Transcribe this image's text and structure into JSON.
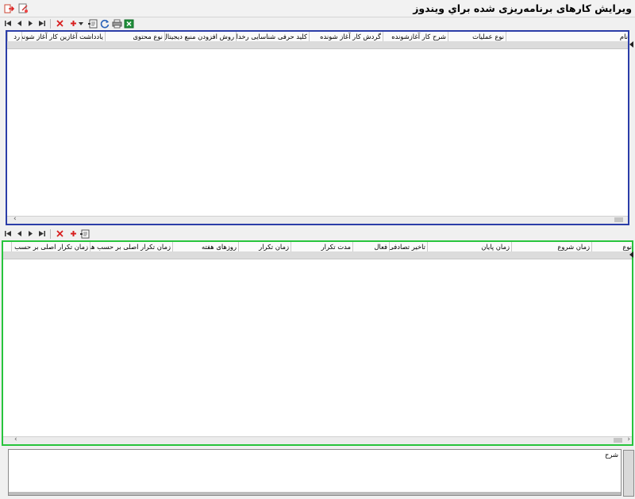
{
  "window": {
    "title": "ويرايش کارهای برنامه‌ریزی شده براي ويندوز"
  },
  "top_toolbar": {
    "icons": [
      "first-icon",
      "prev-icon",
      "next-icon",
      "last-icon",
      "delete-icon",
      "add-icon",
      "dropdown-icon",
      "edit-icon",
      "refresh-icon",
      "print-icon",
      "excel-icon"
    ]
  },
  "main_grid": {
    "columns": [
      "نام",
      "نوع عمليات",
      "شرح کار آغازشونده",
      "گردش کار آغاز شونده",
      "کليد حرفی شناسايی رخداد",
      "روش افزودن منبع ديجيتال",
      "نوع محتوی",
      "يادداشت آغازين کار آغاز شونده",
      "رد"
    ]
  },
  "second_toolbar": {
    "icons": [
      "first-icon",
      "prev-icon",
      "next-icon",
      "last-icon",
      "delete-icon",
      "add-icon",
      "edit-icon"
    ]
  },
  "schedule_grid": {
    "columns": [
      "نوع",
      "زمان شروع",
      "زمان پايان",
      "تاخير تصادفی",
      "فعال",
      "مدت تکرار",
      "زمان تکرار",
      "روزهای هفته",
      "زمان تکرار اصلی بر حسب هفته",
      "زمان تکرار اصلی بر حسب روز"
    ]
  },
  "description": {
    "label": "شرح"
  },
  "colors": {
    "main_grid_border": "#2b3da8",
    "schedule_grid_border": "#27c43c"
  }
}
